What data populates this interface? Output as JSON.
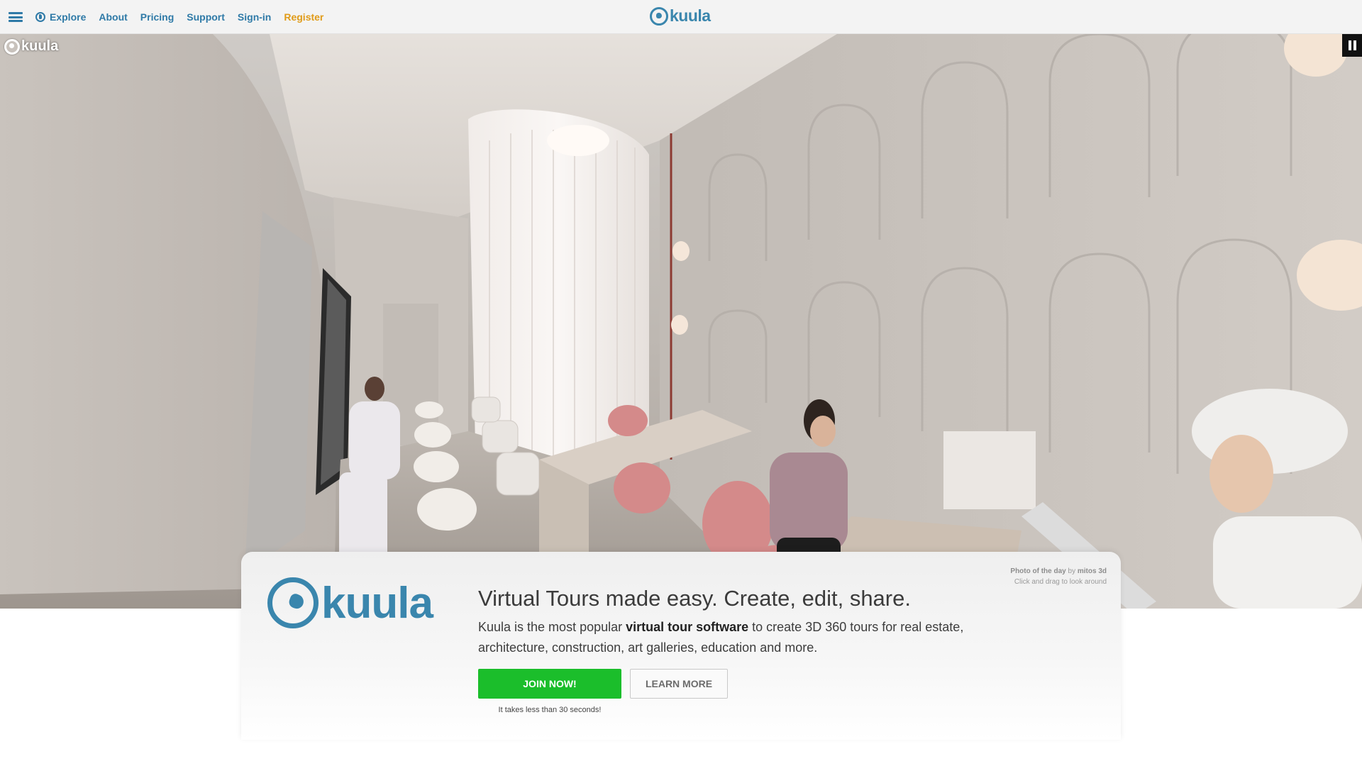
{
  "nav": {
    "explore": "Explore",
    "about": "About",
    "pricing": "Pricing",
    "support": "Support",
    "signin": "Sign-in",
    "register": "Register",
    "logo": "kuula"
  },
  "hero": {
    "watermark": "kuula",
    "pause_icon": "pause-icon"
  },
  "card": {
    "logo": "kuula",
    "credit_label": "Photo of the day",
    "credit_by": "by",
    "credit_author": "mitos 3d",
    "credit_hint": "Click and drag to look around",
    "heading": "Virtual Tours made easy. Create, edit, share.",
    "desc_prefix": "Kuula is the most popular ",
    "desc_bold": "virtual tour software",
    "desc_suffix": " to create 3D 360 tours for real estate, architecture, construction, art galleries, education and more.",
    "join_label": "JOIN NOW!",
    "learn_label": "LEARN MORE",
    "join_note": "It takes less than 30 seconds!"
  },
  "colors": {
    "brand": "#3a86ad",
    "nav_link": "#2f7aa7",
    "register": "#e09b18",
    "join_button": "#1bbe2b"
  }
}
